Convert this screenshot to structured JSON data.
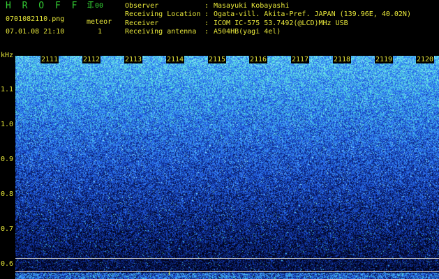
{
  "header": {
    "app_title": "H R O F F T",
    "app_version": "1.00",
    "file_name": "0701082110.png",
    "meteor_label": "meteor",
    "datetime": "07.01.08 21:10",
    "meteor_count": "1"
  },
  "info": [
    {
      "label": "Observer",
      "value": "Masayuki Kobayashi"
    },
    {
      "label": "Receiving Location",
      "value": "Ogata-vill. Akita-Pref. JAPAN (139.96E, 40.02N)"
    },
    {
      "label": "Receiver",
      "value": "ICOM IC-575 53.7492(@LCD)MHz USB"
    },
    {
      "label": "Receiving antenna",
      "value": "A504HB(yagi 4el)"
    }
  ],
  "info_separator": ":",
  "chart_data": {
    "type": "heatmap",
    "yunit": "kHz",
    "yticks": [
      "1.1",
      "1.0",
      "0.9",
      "0.8",
      "0.7",
      "0.6"
    ],
    "xticks": [
      "2111",
      "2112",
      "2113",
      "2114",
      "2115",
      "2116",
      "2117",
      "2118",
      "2119",
      "2120"
    ],
    "colormap": [
      "#000010",
      "#081a6a",
      "#1a4fd6",
      "#3a8cff",
      "#52e0d8",
      "#9cf0ff"
    ]
  }
}
